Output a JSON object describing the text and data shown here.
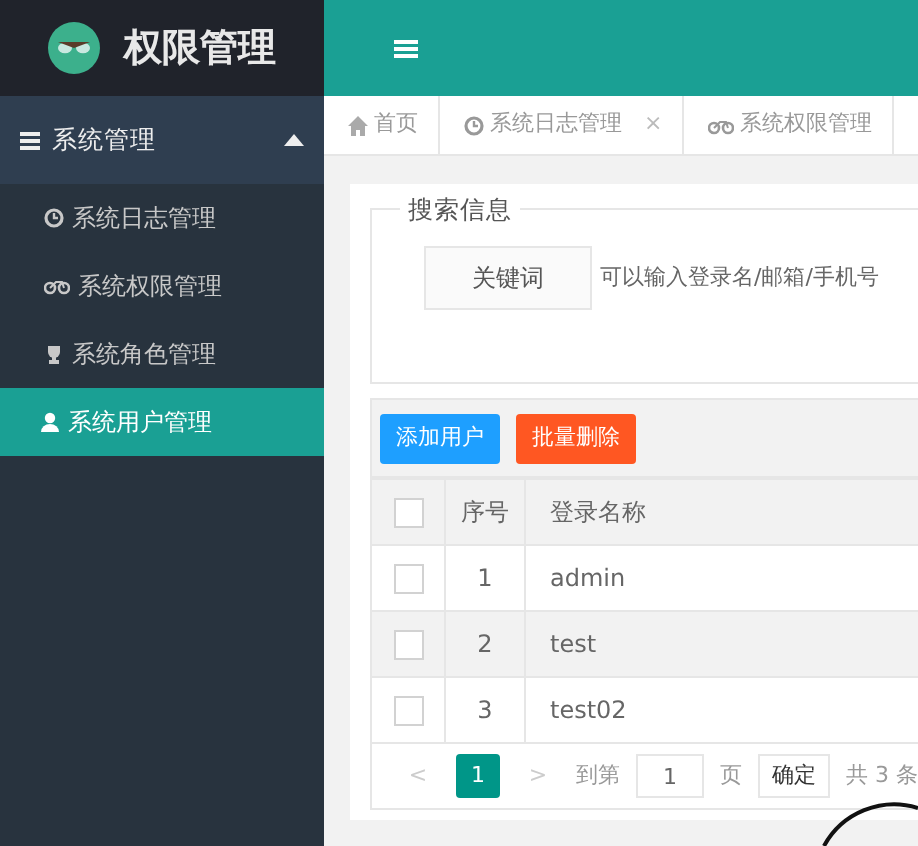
{
  "app": {
    "title": "权限管理"
  },
  "sidebar": {
    "group": {
      "label": "系统管理",
      "expanded": true
    },
    "items": [
      {
        "label": "系统日志管理",
        "selected": false
      },
      {
        "label": "系统权限管理",
        "selected": false
      },
      {
        "label": "系统角色管理",
        "selected": false
      },
      {
        "label": "系统用户管理",
        "selected": true
      }
    ]
  },
  "tabs": [
    {
      "label": "首页"
    },
    {
      "label": "系统日志管理",
      "close": "×"
    },
    {
      "label": "系统权限管理"
    }
  ],
  "search": {
    "legend": "搜索信息",
    "label": "关键词",
    "placeholder": "可以输入登录名/邮箱/手机号"
  },
  "buttons": [
    {
      "label": "添加用户",
      "kind": "primary"
    },
    {
      "label": "批量删除",
      "kind": "danger"
    }
  ],
  "table": {
    "select_all_checked": false,
    "columns": [
      "序号",
      "登录名称"
    ],
    "rows": [
      {
        "index": "1",
        "name": "admin",
        "checked": false,
        "highlighted": false
      },
      {
        "index": "2",
        "name": "test",
        "checked": false,
        "highlighted": true
      },
      {
        "index": "3",
        "name": "test02",
        "checked": false,
        "highlighted": false
      }
    ]
  },
  "pager": {
    "prev": "<",
    "pages": [
      {
        "label": "1",
        "selected": true
      }
    ],
    "next": ">",
    "goto": "到第",
    "page_value": "1",
    "page_unit": "页",
    "confirm": "确定",
    "total": "共 3 条"
  }
}
